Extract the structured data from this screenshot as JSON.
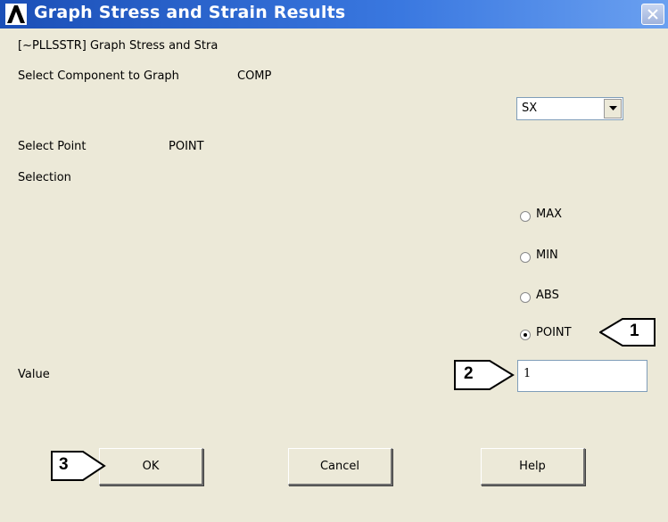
{
  "window": {
    "title": "Graph Stress and Strain Results"
  },
  "header_text": "[~PLLSSTR] Graph Stress and Stra",
  "component": {
    "label": "Select Component to Graph",
    "param": "COMP",
    "selected": "SX"
  },
  "point": {
    "label": "Select Point",
    "param": "POINT"
  },
  "selection": {
    "label": "Selection"
  },
  "radios": [
    {
      "label": "MAX",
      "checked": false
    },
    {
      "label": "MIN",
      "checked": false
    },
    {
      "label": "ABS",
      "checked": false
    },
    {
      "label": "POINT",
      "checked": true
    }
  ],
  "value": {
    "label": "Value",
    "input": "1"
  },
  "buttons": {
    "ok": "OK",
    "cancel": "Cancel",
    "help": "Help"
  },
  "callouts": [
    "1",
    "2",
    "3"
  ],
  "colors": {
    "titlebar": "#1b4fb7",
    "background": "#ece9d8"
  }
}
